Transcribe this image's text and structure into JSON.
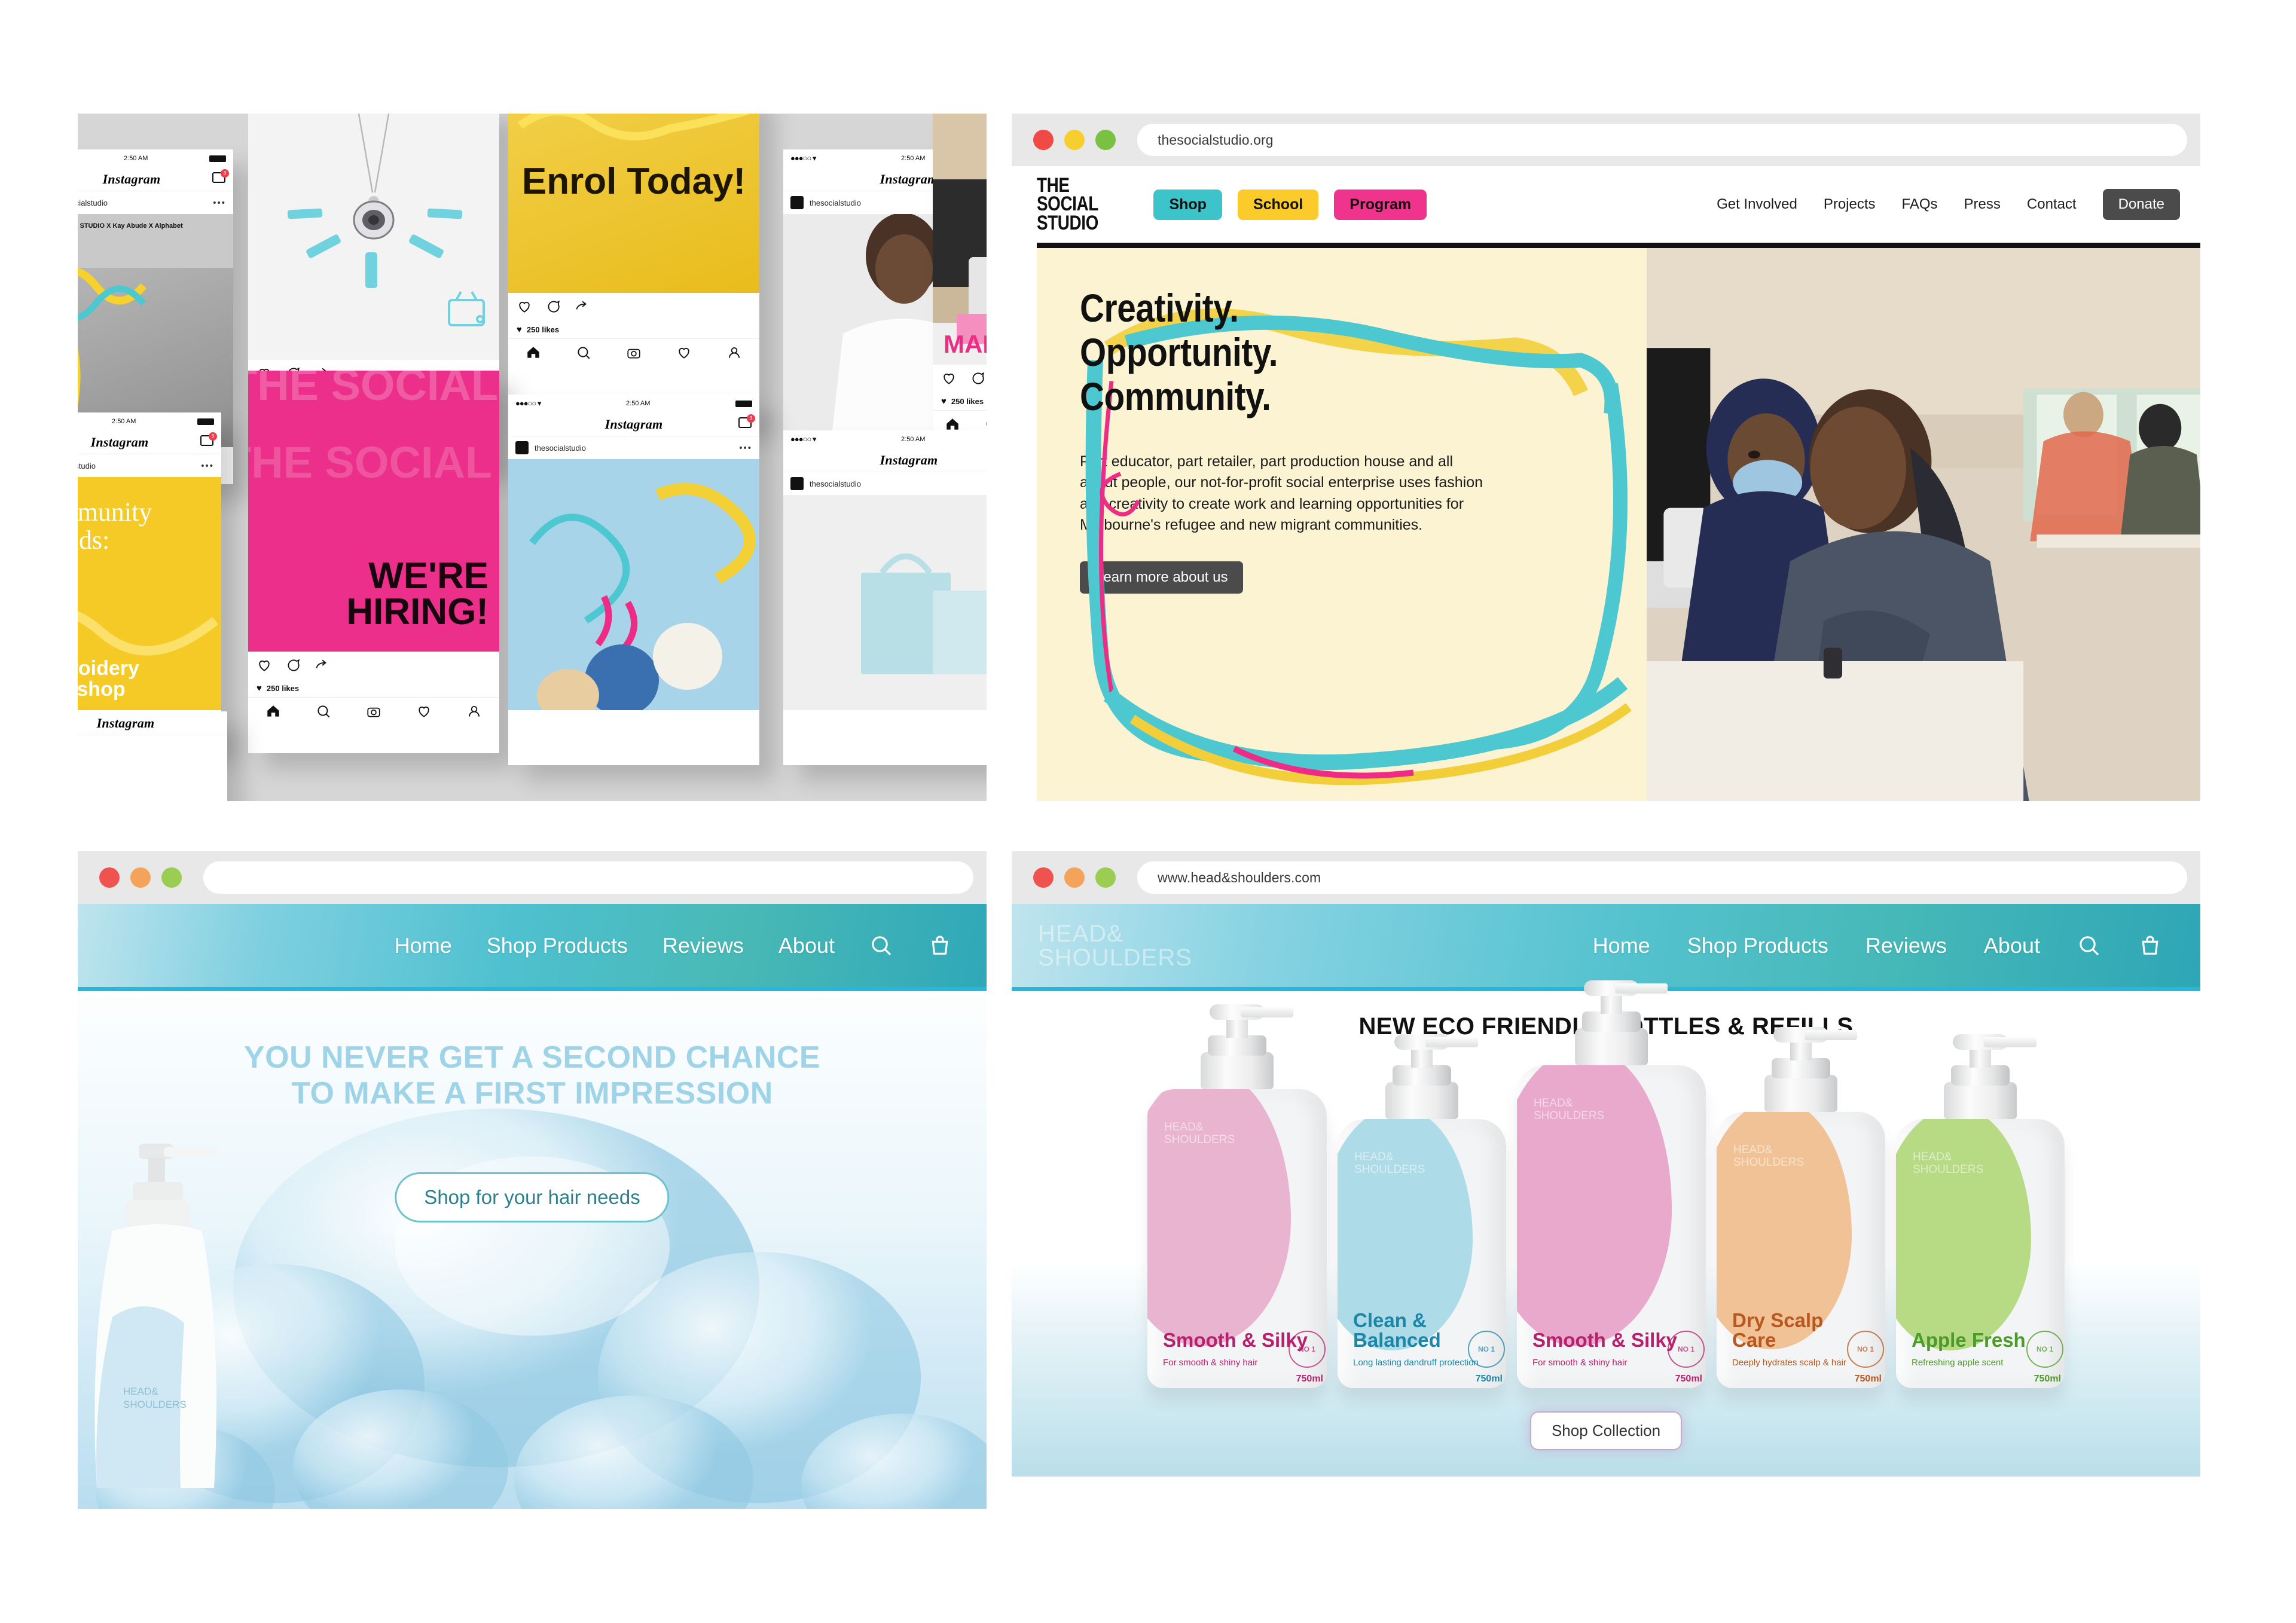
{
  "page": {
    "background": "#ffffff"
  },
  "panels": {
    "collage": {
      "name": "instagram-collage",
      "background": "#d6d6d6",
      "posts": [
        {
          "time": "2:50 AM",
          "app": "Instagram",
          "handle": "thesocialstudio",
          "likes": "250 likes",
          "caption": "",
          "badge": "3"
        },
        {
          "time": "2:50 AM",
          "app": "Instagram",
          "handle": "thesocialstudio",
          "likes": "250 likes",
          "caption": "Enrol Today!",
          "badge": "3"
        },
        {
          "time": "2:50 AM",
          "app": "Instagram",
          "handle": "thesocialstudio",
          "likes": "250 likes",
          "caption": "WE'RE HIRING!",
          "badge": "3"
        },
        {
          "time": "2:50 AM",
          "app": "Instagram",
          "handle": "thesocialstudio",
          "likes": "250 likes",
          "caption": "MADE WITH",
          "badge": "3"
        }
      ],
      "graphics": {
        "collab": "THE SOCIAL STUDIO  X  Kay Abude  X  Alphabet",
        "community_line1": "Community",
        "community_line2": "threads:",
        "community_line3": "Embroidery",
        "community_line4": "Workshop",
        "hiring_line1": "WE'RE",
        "hiring_line2": "HIRING!",
        "hiring_bg_text": "THE SOCIAL STUDIO",
        "enrol": "Enrol Today!",
        "made_with": "MADE WITH"
      }
    },
    "social_studio": {
      "name": "the-social-studio-website",
      "url": "thesocialstudio.org",
      "logo_lines": [
        "THE",
        "SOCIAL",
        "STUDIO"
      ],
      "pills": [
        {
          "label": "Shop",
          "color": "#3dc4ca"
        },
        {
          "label": "School",
          "color": "#fbcb2b"
        },
        {
          "label": "Program",
          "color": "#f0338c"
        }
      ],
      "links": [
        "Get Involved",
        "Projects",
        "FAQs",
        "Press",
        "Contact"
      ],
      "donate_label": "Donate",
      "hero": {
        "background": "#fbf3d2",
        "headline": [
          "Creativity.",
          "Opportunity.",
          "Community."
        ],
        "body": "Part educator, part retailer, part production house and all about people, our not-for-profit social enterprise uses fashion and creativity to create work and learning opportunities for Melbourne's refugee and new migrant communities.",
        "cta": "Learn more about us",
        "image_alt": "Two women sewing at machines in a studio workroom"
      }
    },
    "hs_home": {
      "name": "head-and-shoulders-home",
      "url": "",
      "nav": [
        "Home",
        "Shop Products",
        "Reviews",
        "About"
      ],
      "icons": [
        "search-icon",
        "bag-icon"
      ],
      "headline_line1": "YOU NEVER GET A SECOND CHANCE",
      "headline_line2": "TO MAKE A FIRST IMPRESSION",
      "cta": "Shop for your hair needs",
      "accent": "#9fd3e8",
      "cta_color": "#2c7f8c"
    },
    "hs_products": {
      "name": "head-and-shoulders-products",
      "url": "www.head&shoulders.com",
      "logo_lines": [
        "HEAD&",
        "SHOULDERS"
      ],
      "nav": [
        "Home",
        "Shop Products",
        "Reviews",
        "About"
      ],
      "icons": [
        "search-icon",
        "bag-icon"
      ],
      "section_title": "NEW ECO FRIENDLY BOTTLES & REFILLS",
      "cta": "Shop Collection",
      "brand_on_bottle": [
        "HEAD&",
        "SHOULDERS"
      ],
      "seal_text": "NO 1",
      "bottles": [
        {
          "name": "Smooth & Silky",
          "desc": "For smooth & shiny hair",
          "size": "750ml",
          "color": "#e9b4d0",
          "text_color": "#b5216c"
        },
        {
          "name": "Clean & Balanced",
          "desc": "Long lasting dandruff protection",
          "size": "750ml",
          "color": "#aedbe8",
          "text_color": "#1b86a8"
        },
        {
          "name": "Smooth & Silky",
          "desc": "For smooth & shiny hair",
          "size": "750ml",
          "color": "#e9a9cd",
          "text_color": "#b5216c"
        },
        {
          "name": "Dry Scalp Care",
          "desc": "Deeply hydrates scalp & hair",
          "size": "750ml",
          "color": "#f0c296",
          "text_color": "#b8571e"
        },
        {
          "name": "Apple Fresh",
          "desc": "Refreshing apple scent",
          "size": "750ml",
          "color": "#b6db84",
          "text_color": "#4c9a2a"
        }
      ]
    }
  }
}
